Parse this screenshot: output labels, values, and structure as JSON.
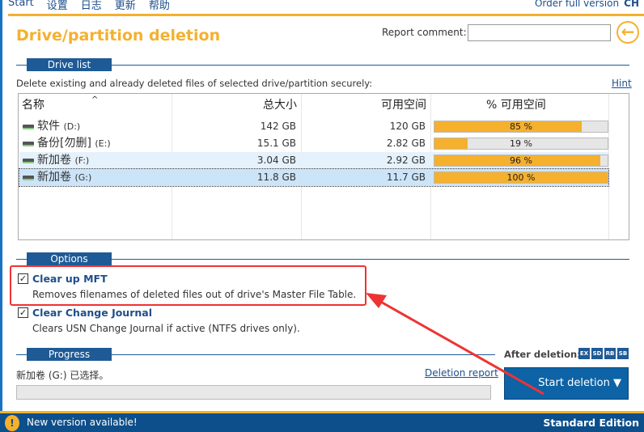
{
  "menu": {
    "items": [
      "Start",
      "设置",
      "日志",
      "更新",
      "帮助"
    ],
    "order": "Order full version",
    "lang": "CH"
  },
  "header": {
    "title": "Drive/partition deletion",
    "report_label": "Report comment:",
    "report_value": "",
    "back_icon": "arrow-left-icon"
  },
  "drive_list": {
    "section": "Drive list",
    "description": "Delete existing and already deleted files of selected drive/partition securely:",
    "hint": "Hint",
    "columns": [
      "名称",
      "总大小",
      "可用空间",
      "% 可用空间"
    ],
    "rows": [
      {
        "name": "软件",
        "letter": "(D:)",
        "total": "142 GB",
        "free": "120 GB",
        "pct": 85,
        "pct_label": "85 %"
      },
      {
        "name": "备份[勿删]",
        "letter": "(E:)",
        "total": "15.1 GB",
        "free": "2.82 GB",
        "pct": 19,
        "pct_label": "19 %"
      },
      {
        "name": "新加卷",
        "letter": "(F:)",
        "total": "3.04 GB",
        "free": "2.92 GB",
        "pct": 96,
        "pct_label": "96 %"
      },
      {
        "name": "新加卷",
        "letter": "(G:)",
        "total": "11.8 GB",
        "free": "11.7 GB",
        "pct": 100,
        "pct_label": "100 %"
      }
    ]
  },
  "options": {
    "section": "Options",
    "items": [
      {
        "title": "Clear up MFT",
        "desc": "Removes filenames of deleted files out of drive's Master File Table.",
        "checked": true
      },
      {
        "title": "Clear Change Journal",
        "desc": "Clears USN Change Journal if active (NTFS drives only).",
        "checked": true
      }
    ]
  },
  "progress": {
    "section": "Progress",
    "status": "新加卷 (G:) 已选择。",
    "report_link": "Deletion report",
    "value": 0
  },
  "after": {
    "label": "After deletion:",
    "badges": [
      "EX",
      "SD",
      "RB",
      "SB"
    ]
  },
  "start_button": "Start deletion",
  "footer": {
    "new_version": "New version available!",
    "edition": "Standard Edition"
  },
  "colors": {
    "accent": "#f5b02e",
    "brand": "#1e5a96",
    "annotation": "#e33"
  }
}
